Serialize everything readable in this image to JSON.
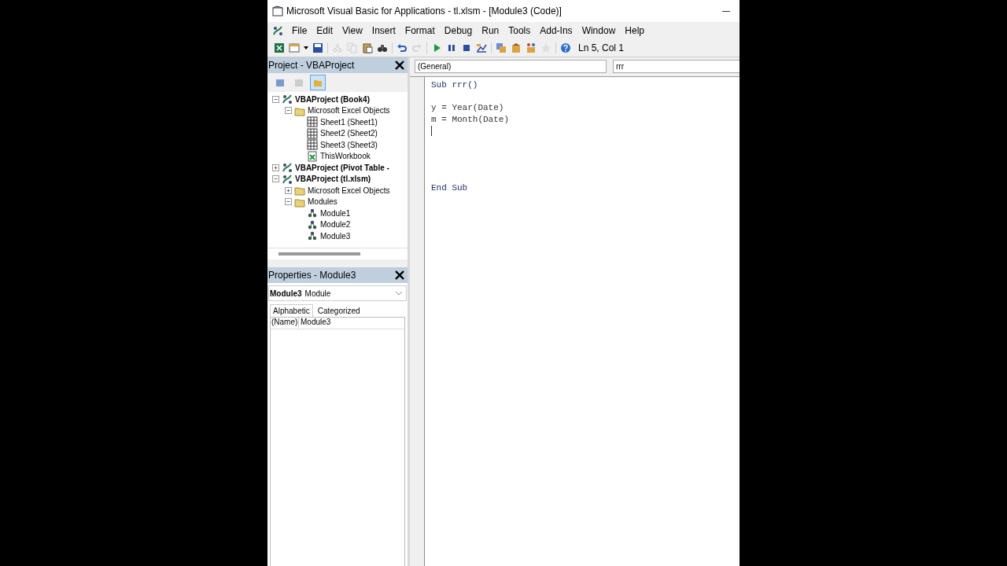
{
  "window": {
    "title": "Microsoft Visual Basic for Applications - tl.xlsm - [Module3 (Code)]"
  },
  "menu": [
    "File",
    "Edit",
    "View",
    "Insert",
    "Format",
    "Debug",
    "Run",
    "Tools",
    "Add-Ins",
    "Window",
    "Help"
  ],
  "toolbar": {
    "buttons": [
      {
        "kind": "excel",
        "disabled": false
      },
      {
        "kind": "insert",
        "disabled": false
      },
      {
        "kind": "save",
        "disabled": false
      },
      {
        "kind": "cut",
        "disabled": true
      },
      {
        "kind": "copy",
        "disabled": true
      },
      {
        "kind": "paste",
        "disabled": false
      },
      {
        "kind": "find",
        "disabled": false
      },
      {
        "kind": "undo",
        "disabled": false
      },
      {
        "kind": "redo",
        "disabled": true
      },
      {
        "kind": "run",
        "disabled": false
      },
      {
        "kind": "pause",
        "disabled": false
      },
      {
        "kind": "stop",
        "disabled": false
      },
      {
        "kind": "design",
        "disabled": false
      },
      {
        "kind": "explorer",
        "disabled": false
      },
      {
        "kind": "properties",
        "disabled": false
      },
      {
        "kind": "browser",
        "disabled": false
      },
      {
        "kind": "toolbox",
        "disabled": true
      },
      {
        "kind": "help",
        "disabled": false
      }
    ],
    "position": "Ln 5, Col 1"
  },
  "project_panel": {
    "title": "Project - VBAProject",
    "view_buttons": [
      {
        "kind": "code",
        "selected": false
      },
      {
        "kind": "object",
        "selected": false
      },
      {
        "kind": "folders",
        "selected": true
      }
    ],
    "tree": [
      {
        "label": "VBAProject (Book4)",
        "kind": "project",
        "expanded": true,
        "children": [
          {
            "label": "Microsoft Excel Objects",
            "kind": "folder",
            "expanded": true,
            "children": [
              {
                "label": "Sheet1 (Sheet1)",
                "kind": "sheet"
              },
              {
                "label": "Sheet2 (Sheet2)",
                "kind": "sheet"
              },
              {
                "label": "Sheet3 (Sheet3)",
                "kind": "sheet"
              },
              {
                "label": "ThisWorkbook",
                "kind": "workbook"
              }
            ]
          }
        ]
      },
      {
        "label": "VBAProject (Pivot Table -",
        "kind": "project",
        "expanded": false
      },
      {
        "label": "VBAProject (tl.xlsm)",
        "kind": "project",
        "expanded": true,
        "children": [
          {
            "label": "Microsoft Excel Objects",
            "kind": "folder",
            "expanded": false
          },
          {
            "label": "Modules",
            "kind": "folder",
            "expanded": true,
            "children": [
              {
                "label": "Module1",
                "kind": "module"
              },
              {
                "label": "Module2",
                "kind": "module"
              },
              {
                "label": "Module3",
                "kind": "module"
              }
            ]
          }
        ]
      }
    ]
  },
  "properties_panel": {
    "title": "Properties - Module3",
    "object_name": "Module3",
    "object_type": "Module",
    "tabs": [
      {
        "label": "Alphabetic",
        "selected": true
      },
      {
        "label": "Categorized",
        "selected": false
      }
    ],
    "rows": [
      {
        "name": "(Name)",
        "value": "Module3"
      }
    ]
  },
  "code_window": {
    "object_box": "(General)",
    "procedure_box": "rrr",
    "lines": [
      {
        "kind": "keyword",
        "text": "Sub rrr()"
      },
      {
        "kind": "blank"
      },
      {
        "kind": "code",
        "text": "y = Year(Date)"
      },
      {
        "kind": "code",
        "text": "m = Month(Date)"
      },
      {
        "kind": "cursor"
      },
      {
        "kind": "blank"
      },
      {
        "kind": "blank"
      },
      {
        "kind": "blank"
      },
      {
        "kind": "blank"
      },
      {
        "kind": "keyword",
        "text": "End Sub"
      }
    ]
  }
}
